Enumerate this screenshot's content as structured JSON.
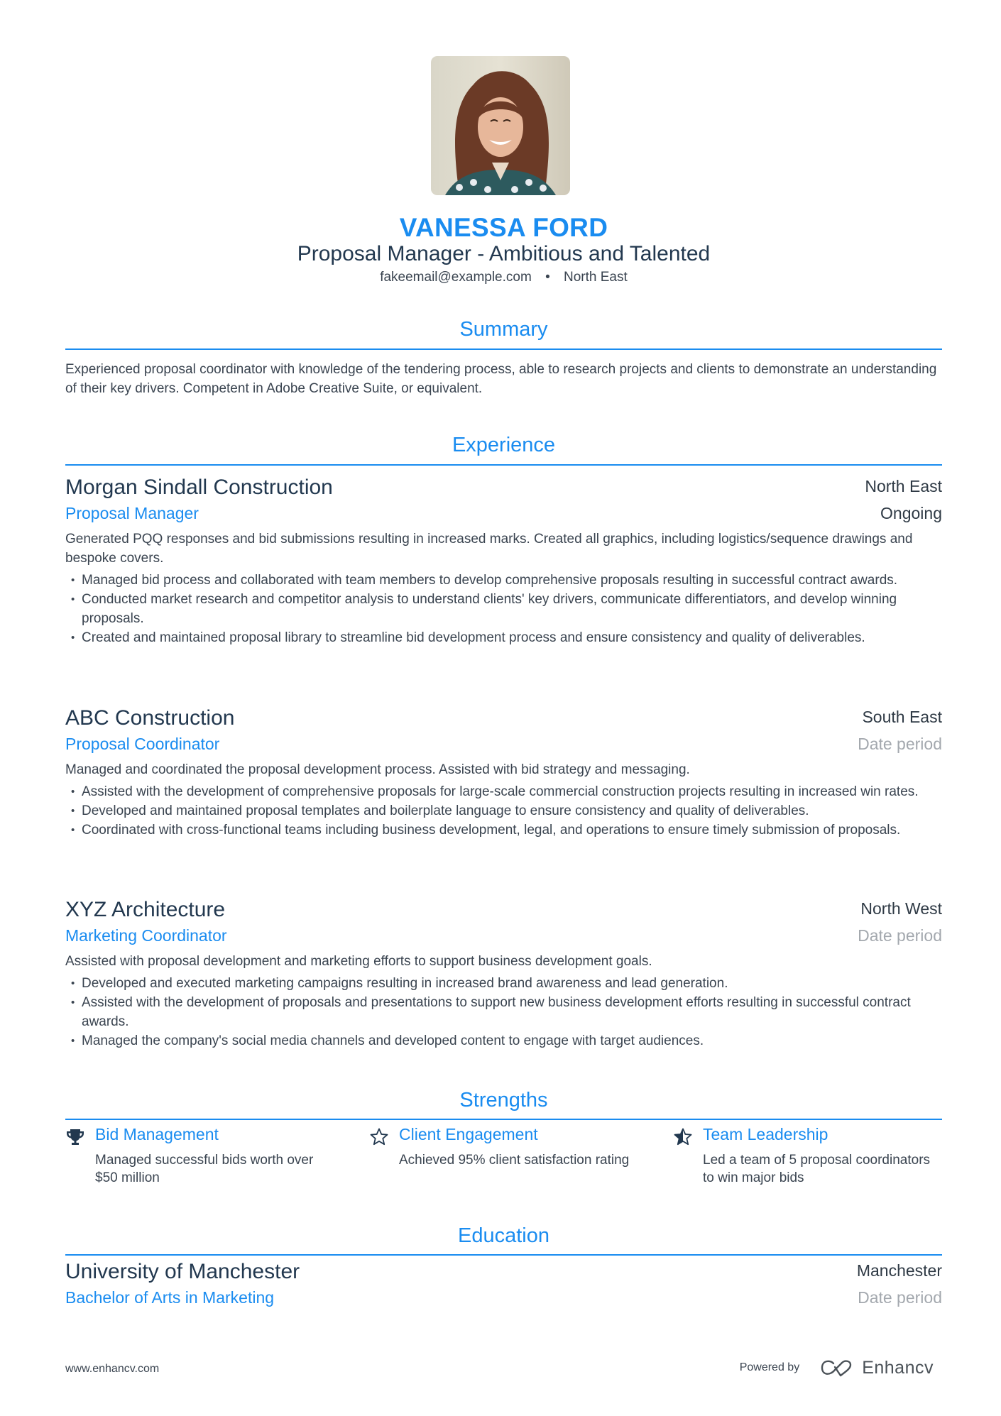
{
  "header": {
    "photo_alt": "Portrait of Vanessa Ford",
    "name": "VANESSA FORD",
    "headline": "Proposal Manager - Ambitious and Talented",
    "email": "fakeemail@example.com",
    "separator": "•",
    "location": "North East"
  },
  "colors": {
    "accent": "#1a8cf0",
    "heading_dark": "#22384f",
    "body_text": "#3a4450",
    "muted": "#a3a8ae"
  },
  "summary": {
    "title": "Summary",
    "text": "Experienced proposal coordinator with knowledge of the tendering process, able to research projects and clients to demonstrate an understanding of their key drivers. Competent in Adobe Creative Suite, or equivalent."
  },
  "experience": {
    "title": "Experience",
    "jobs": [
      {
        "company": "Morgan Sindall Construction",
        "location": "North East",
        "role": "Proposal Manager",
        "period": "Ongoing",
        "description": "Generated PQQ responses and bid submissions resulting in increased marks. Created all graphics, including logistics/sequence drawings and bespoke covers.",
        "bullets": [
          "Managed bid process and collaborated with team members to develop comprehensive proposals resulting in successful contract awards.",
          "Conducted market research and competitor analysis to understand clients' key drivers, communicate differentiators, and develop winning proposals.",
          "Created and maintained proposal library to streamline bid development process and ensure consistency and quality of deliverables."
        ]
      },
      {
        "company": "ABC Construction",
        "location": "South East",
        "role": "Proposal Coordinator",
        "period": "Date period",
        "description": "Managed and coordinated the proposal development process. Assisted with bid strategy and messaging.",
        "bullets": [
          "Assisted with the development of comprehensive proposals for large-scale commercial construction projects resulting in increased win rates.",
          "Developed and maintained proposal templates and boilerplate language to ensure consistency and quality of deliverables.",
          "Coordinated with cross-functional teams including business development, legal, and operations to ensure timely submission of proposals."
        ]
      },
      {
        "company": "XYZ Architecture",
        "location": "North West",
        "role": "Marketing Coordinator",
        "period": "Date period",
        "description": "Assisted with proposal development and marketing efforts to support business development goals.",
        "bullets": [
          "Developed and executed marketing campaigns resulting in increased brand awareness and lead generation.",
          "Assisted with the development of proposals and presentations to support new business development efforts resulting in successful contract awards.",
          "Managed the company's social media channels and developed content to engage with target audiences."
        ]
      }
    ]
  },
  "strengths": {
    "title": "Strengths",
    "items": [
      {
        "icon": "trophy-icon",
        "title": "Bid Management",
        "description": "Managed successful bids worth over $50 million"
      },
      {
        "icon": "star-outline-icon",
        "title": "Client Engagement",
        "description": "Achieved 95% client satisfaction rating"
      },
      {
        "icon": "star-half-icon",
        "title": "Team Leadership",
        "description": "Led a team of 5 proposal coordinators to win major bids"
      }
    ]
  },
  "education": {
    "title": "Education",
    "items": [
      {
        "school": "University of Manchester",
        "location": "Manchester",
        "degree": "Bachelor of Arts in Marketing",
        "period": "Date period"
      }
    ]
  },
  "footer": {
    "website": "www.enhancv.com",
    "powered_by": "Powered by",
    "brand": "Enhancv"
  }
}
